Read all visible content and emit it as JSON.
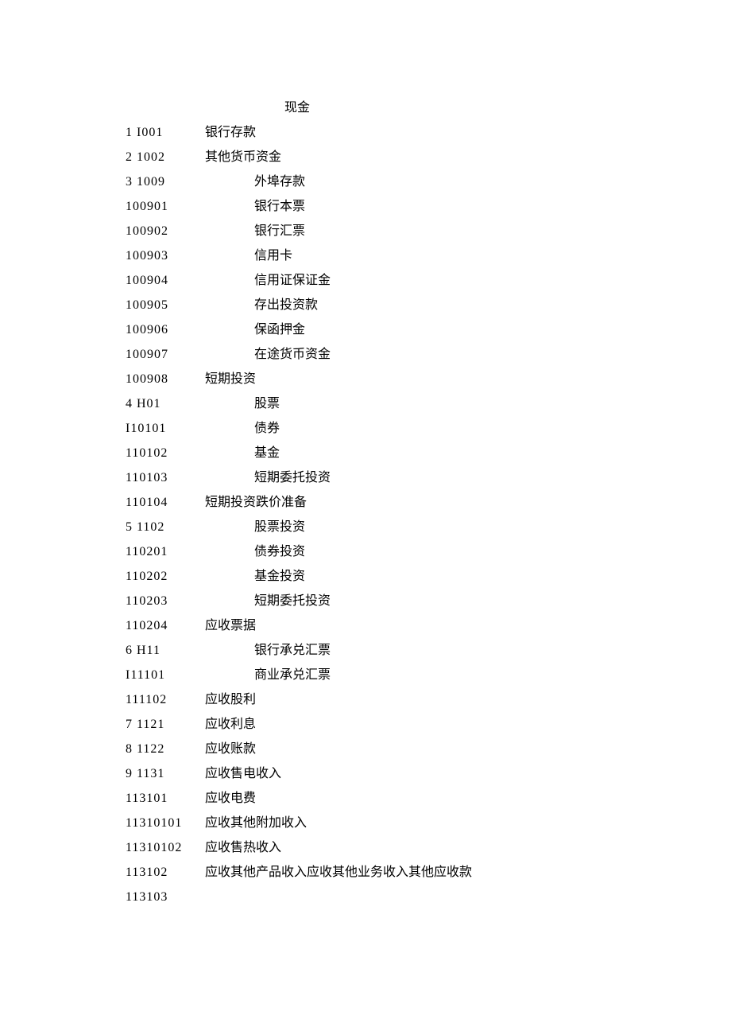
{
  "rows": [
    {
      "code": "",
      "label": "现金",
      "codeClass": "col-code",
      "labelIndent": "indent-0"
    },
    {
      "code": "1 I001",
      "label": "银行存款",
      "codeClass": "col-code",
      "labelIndent": "indent-1"
    },
    {
      "code": "2 1002",
      "label": "其他货币资金",
      "codeClass": "col-code",
      "labelIndent": "indent-1"
    },
    {
      "code": "3 1009",
      "label": "外埠存款",
      "codeClass": "col-code",
      "labelIndent": "indent-2"
    },
    {
      "code": "100901",
      "label": "银行本票",
      "codeClass": "col-code",
      "labelIndent": "indent-2"
    },
    {
      "code": "100902",
      "label": "银行汇票",
      "codeClass": "col-code",
      "labelIndent": "indent-2"
    },
    {
      "code": "100903",
      "label": "信用卡",
      "codeClass": "col-code",
      "labelIndent": "indent-2"
    },
    {
      "code": "100904",
      "label": "信用证保证金",
      "codeClass": "col-code",
      "labelIndent": "indent-2"
    },
    {
      "code": "100905",
      "label": "存出投资款",
      "codeClass": "col-code",
      "labelIndent": "indent-2"
    },
    {
      "code": "100906",
      "label": "保函押金",
      "codeClass": "col-code",
      "labelIndent": "indent-2"
    },
    {
      "code": "100907",
      "label": "在途货币资金",
      "codeClass": "col-code",
      "labelIndent": "indent-2"
    },
    {
      "code": "100908",
      "label": "短期投资",
      "codeClass": "col-code",
      "labelIndent": "indent-1"
    },
    {
      "code": "4 H01",
      "label": "股票",
      "codeClass": "col-code",
      "labelIndent": "indent-2"
    },
    {
      "code": "I10101",
      "label": "债券",
      "codeClass": "col-code",
      "labelIndent": "indent-2"
    },
    {
      "code": "110102",
      "label": "基金",
      "codeClass": "col-code",
      "labelIndent": "indent-2"
    },
    {
      "code": "110103",
      "label": "短期委托投资",
      "codeClass": "col-code",
      "labelIndent": "indent-2"
    },
    {
      "code": "110104",
      "label": "短期投资跌价准备",
      "codeClass": "col-code",
      "labelIndent": "indent-1"
    },
    {
      "code": "5 1102",
      "label": "股票投资",
      "codeClass": "col-code",
      "labelIndent": "indent-2"
    },
    {
      "code": "110201",
      "label": "债券投资",
      "codeClass": "col-code",
      "labelIndent": "indent-2"
    },
    {
      "code": "110202",
      "label": "基金投资",
      "codeClass": "col-code",
      "labelIndent": "indent-2"
    },
    {
      "code": "110203",
      "label": "短期委托投资",
      "codeClass": "col-code",
      "labelIndent": "indent-2"
    },
    {
      "code": "110204",
      "label": "应收票据",
      "codeClass": "col-code",
      "labelIndent": "indent-1"
    },
    {
      "code": "6 H11",
      "label": "银行承兑汇票",
      "codeClass": "col-code",
      "labelIndent": "indent-2"
    },
    {
      "code": "I11101",
      "label": "商业承兑汇票",
      "codeClass": "col-code",
      "labelIndent": "indent-2"
    },
    {
      "code": "111102",
      "label": "应收股利",
      "codeClass": "col-code",
      "labelIndent": "indent-1"
    },
    {
      "code": "7 1121",
      "label": "应收利息",
      "codeClass": "col-code",
      "labelIndent": "indent-1"
    },
    {
      "code": "8 1122",
      "label": "应收账款",
      "codeClass": "col-code",
      "labelIndent": "indent-1"
    },
    {
      "code": "9 1131",
      "label": "应收售电收入",
      "codeClass": "col-code",
      "labelIndent": "indent-1"
    },
    {
      "code": "113101",
      "label": "应收电费",
      "codeClass": "col-code",
      "labelIndent": "indent-1"
    },
    {
      "code": "11310101",
      "label": "应收其他附加收入",
      "codeClass": "col-code",
      "labelIndent": "indent-1"
    },
    {
      "code": "11310102",
      "label": "应收售热收入",
      "codeClass": "col-code",
      "labelIndent": "indent-1"
    },
    {
      "code": "113102",
      "label": "应收其他产品收入应收其他业务收入其他应收款",
      "codeClass": "col-code",
      "labelIndent": "indent-1"
    },
    {
      "code": "113103",
      "label": "",
      "codeClass": "col-code",
      "labelIndent": "indent-1"
    }
  ]
}
